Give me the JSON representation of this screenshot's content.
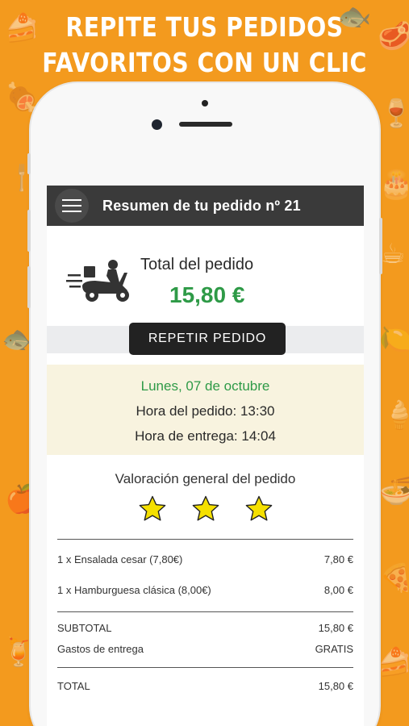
{
  "headline": {
    "line1": "REPITE TUS PEDIDOS",
    "line2": "FAVORITOS CON UN CLIC"
  },
  "appbar": {
    "title": "Resumen de tu pedido nº 21"
  },
  "summary": {
    "total_label": "Total del pedido",
    "total_value": "15,80 €",
    "repeat_button": "REPETIR PEDIDO"
  },
  "schedule": {
    "date": "Lunes, 07 de octubre",
    "order_time": "Hora del pedido: 13:30",
    "delivery_time": "Hora de entrega: 14:04"
  },
  "rating": {
    "title": "Valoración general del pedido",
    "stars": 3,
    "star_color": "#f5e000"
  },
  "items": [
    {
      "description": "1 x  Ensalada cesar (7,80€)",
      "price": "7,80 €"
    },
    {
      "description": "1 x  Hamburguesa clásica (8,00€)",
      "price": "8,00 €"
    }
  ],
  "totals": {
    "subtotal_label": "SUBTOTAL",
    "subtotal_value": "15,80 €",
    "delivery_label": "Gastos de entrega",
    "delivery_value": "GRATIS",
    "total_label": "TOTAL",
    "total_value": "15,80 €"
  },
  "colors": {
    "background": "#f39a1e",
    "accent_green": "#2e9a47",
    "appbar": "#3a3a3a",
    "date_box": "#f8f3df"
  },
  "icons": [
    "menu-icon",
    "delivery-scooter-icon",
    "star-icon"
  ]
}
